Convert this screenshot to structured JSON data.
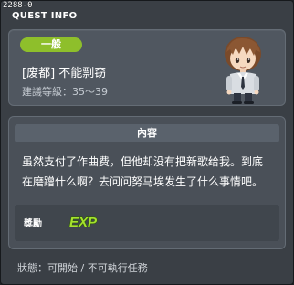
{
  "window": {
    "id": "2288-0",
    "title": "QUEST INFO"
  },
  "header": {
    "category": "一般",
    "quest_name": "[废都] 不能剽窃",
    "level_label": "建議等級：35～39",
    "npc_icon": "npc-boy-avatar-icon"
  },
  "content": {
    "header": "內容",
    "text_line1": "虽然支付了作曲费，但他却没有把新歌给我。到底",
    "text_line2": "在磨蹭什么啊？去问问努马埃发生了什么事情吧。",
    "reward_label": "獎勵",
    "reward_icon": "exp-icon",
    "reward_icon_text": "EXP"
  },
  "status": {
    "text": "狀態：可開始 / 不可執行任務"
  },
  "colors": {
    "badge": "#8ebf2b",
    "exp_fill": "#a6e22e",
    "panel": "#505760",
    "window_bg": "#3a3f45"
  }
}
